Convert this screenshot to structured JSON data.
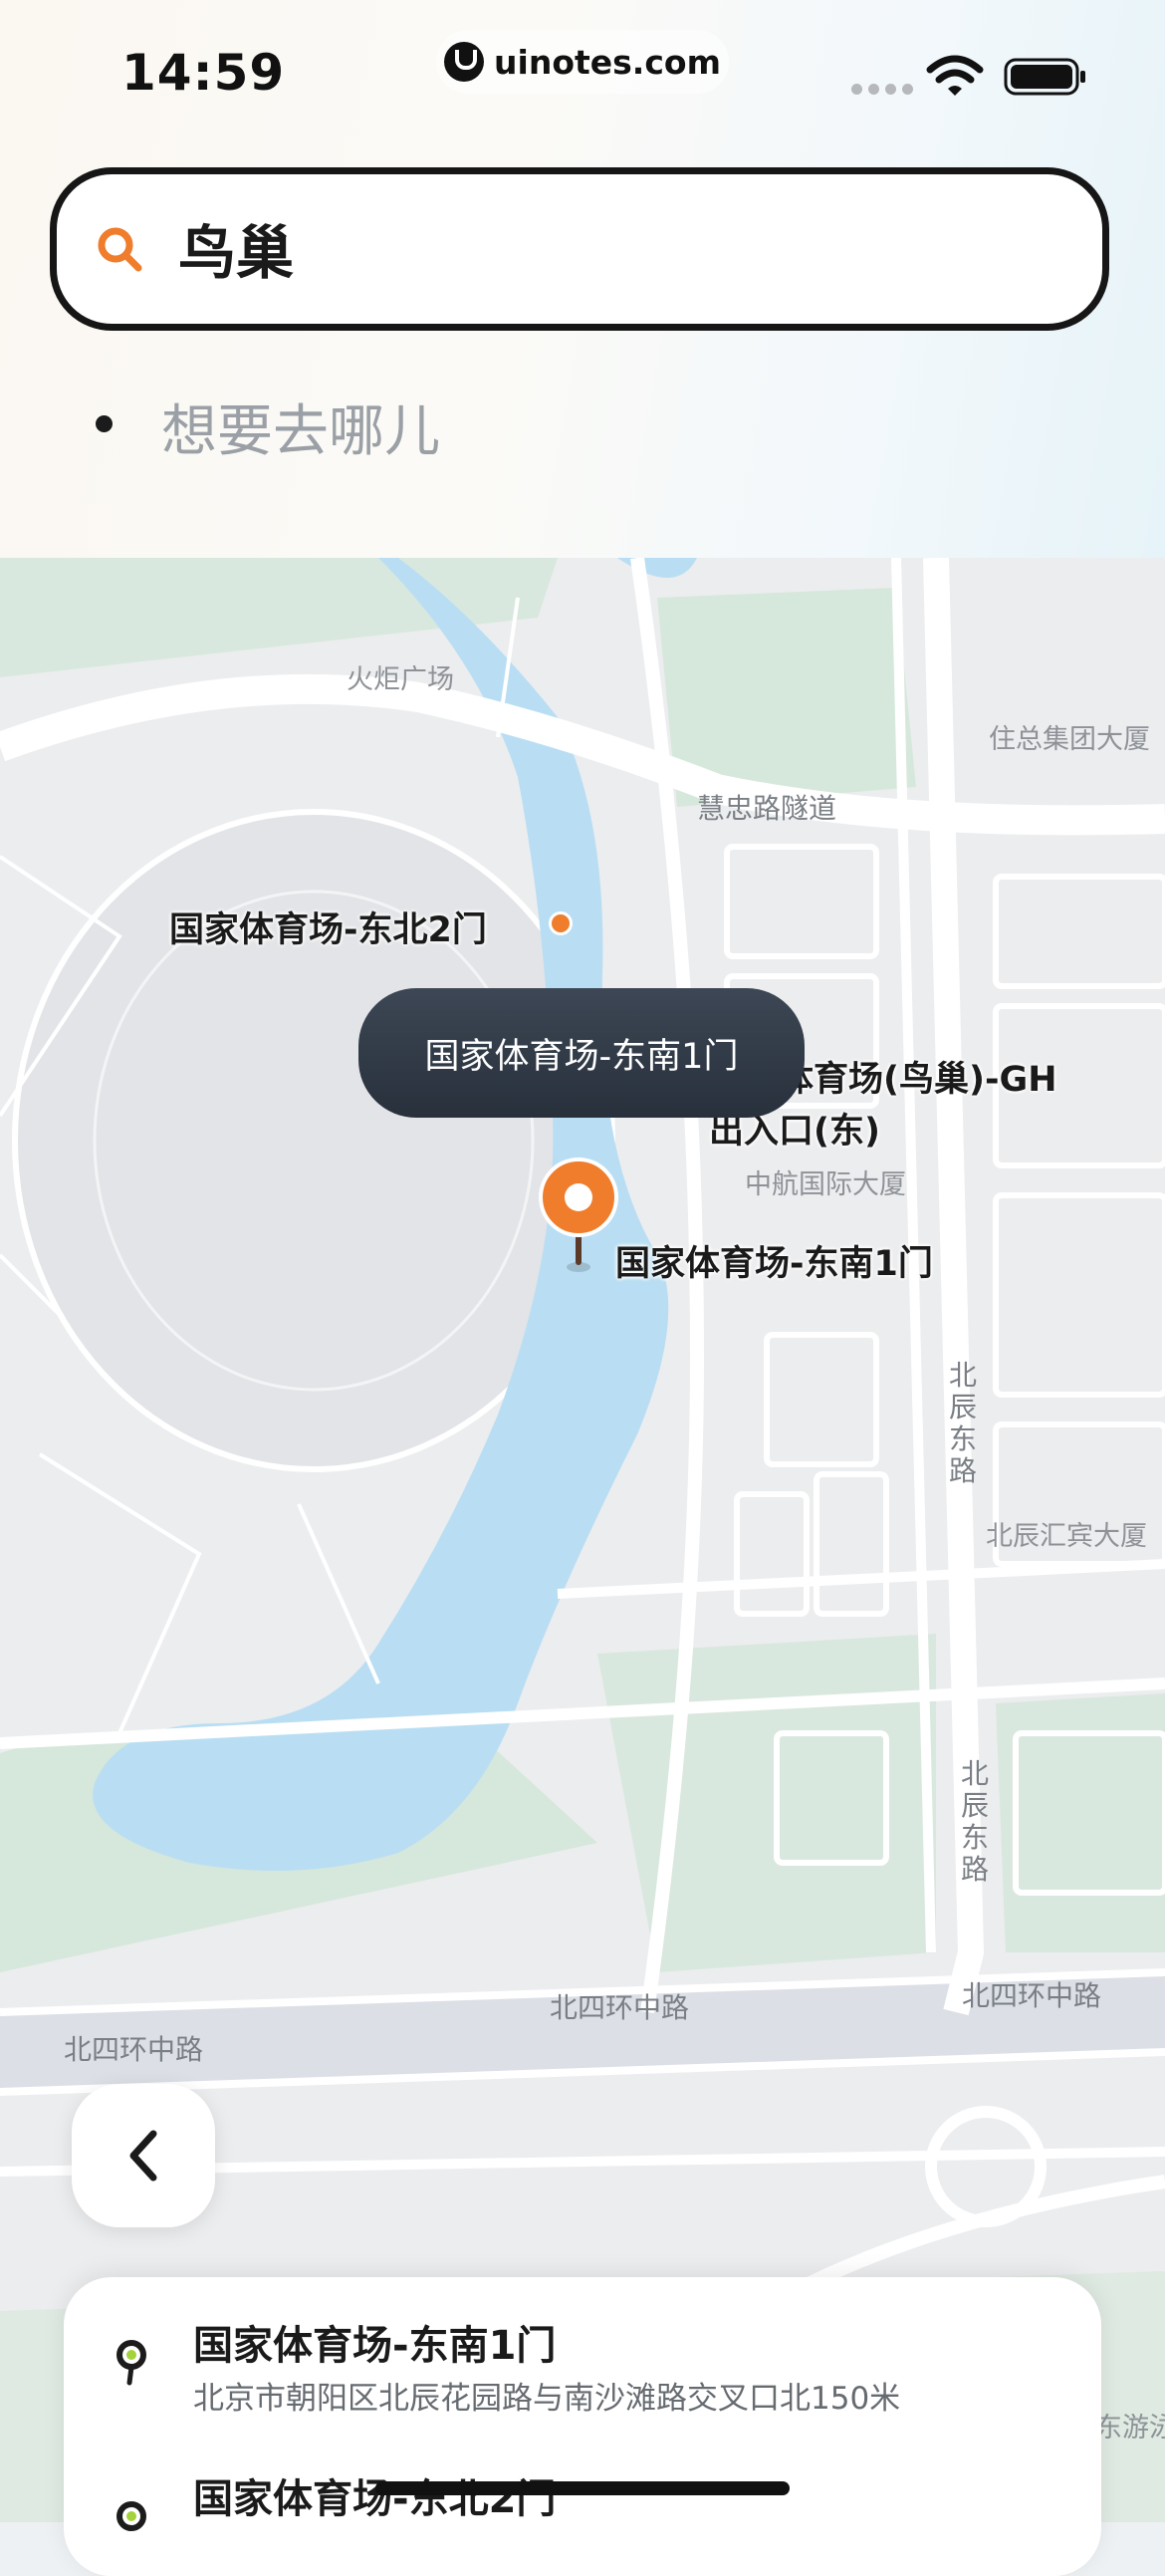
{
  "status_bar": {
    "time": "14:59",
    "url": "uinotes.com"
  },
  "search": {
    "value": "鸟巢",
    "destination_placeholder": "想要去哪儿"
  },
  "map": {
    "area_labels": {
      "plaza": "火炬广场",
      "zhuzong": "住总集团大厦",
      "huizhong_tunnel": "慧忠路隧道",
      "zhonghang": "中航国际大厦",
      "beichen_huibin": "北辰汇宾大厦",
      "beichen_east_road": "北辰东路",
      "north4_ring_center": "北四环中路",
      "north4_ring_right": "北四环中路",
      "north4_ring_left": "北四环中路",
      "partial_bottom_right": "东游泳"
    },
    "poi_labels": {
      "ne_gate": "国家体育场-东北2门",
      "gh_exit": "国家体育场(鸟巢)-GH\n出入口(东)",
      "se_gate": "国家体育场-东南1门"
    },
    "callout": "国家体育场-东南1门",
    "back_icon": "chevron-left-icon"
  },
  "results": [
    {
      "title": "国家体育场-东南1门",
      "address": "北京市朝阳区北辰花园路与南沙滩路交叉口北150米"
    },
    {
      "title": "国家体育场-东北2门",
      "address": ""
    }
  ],
  "colors": {
    "accent": "#ef7d2c",
    "water": "#b9def3",
    "park": "#d6e7dc",
    "road": "#ffffff"
  }
}
